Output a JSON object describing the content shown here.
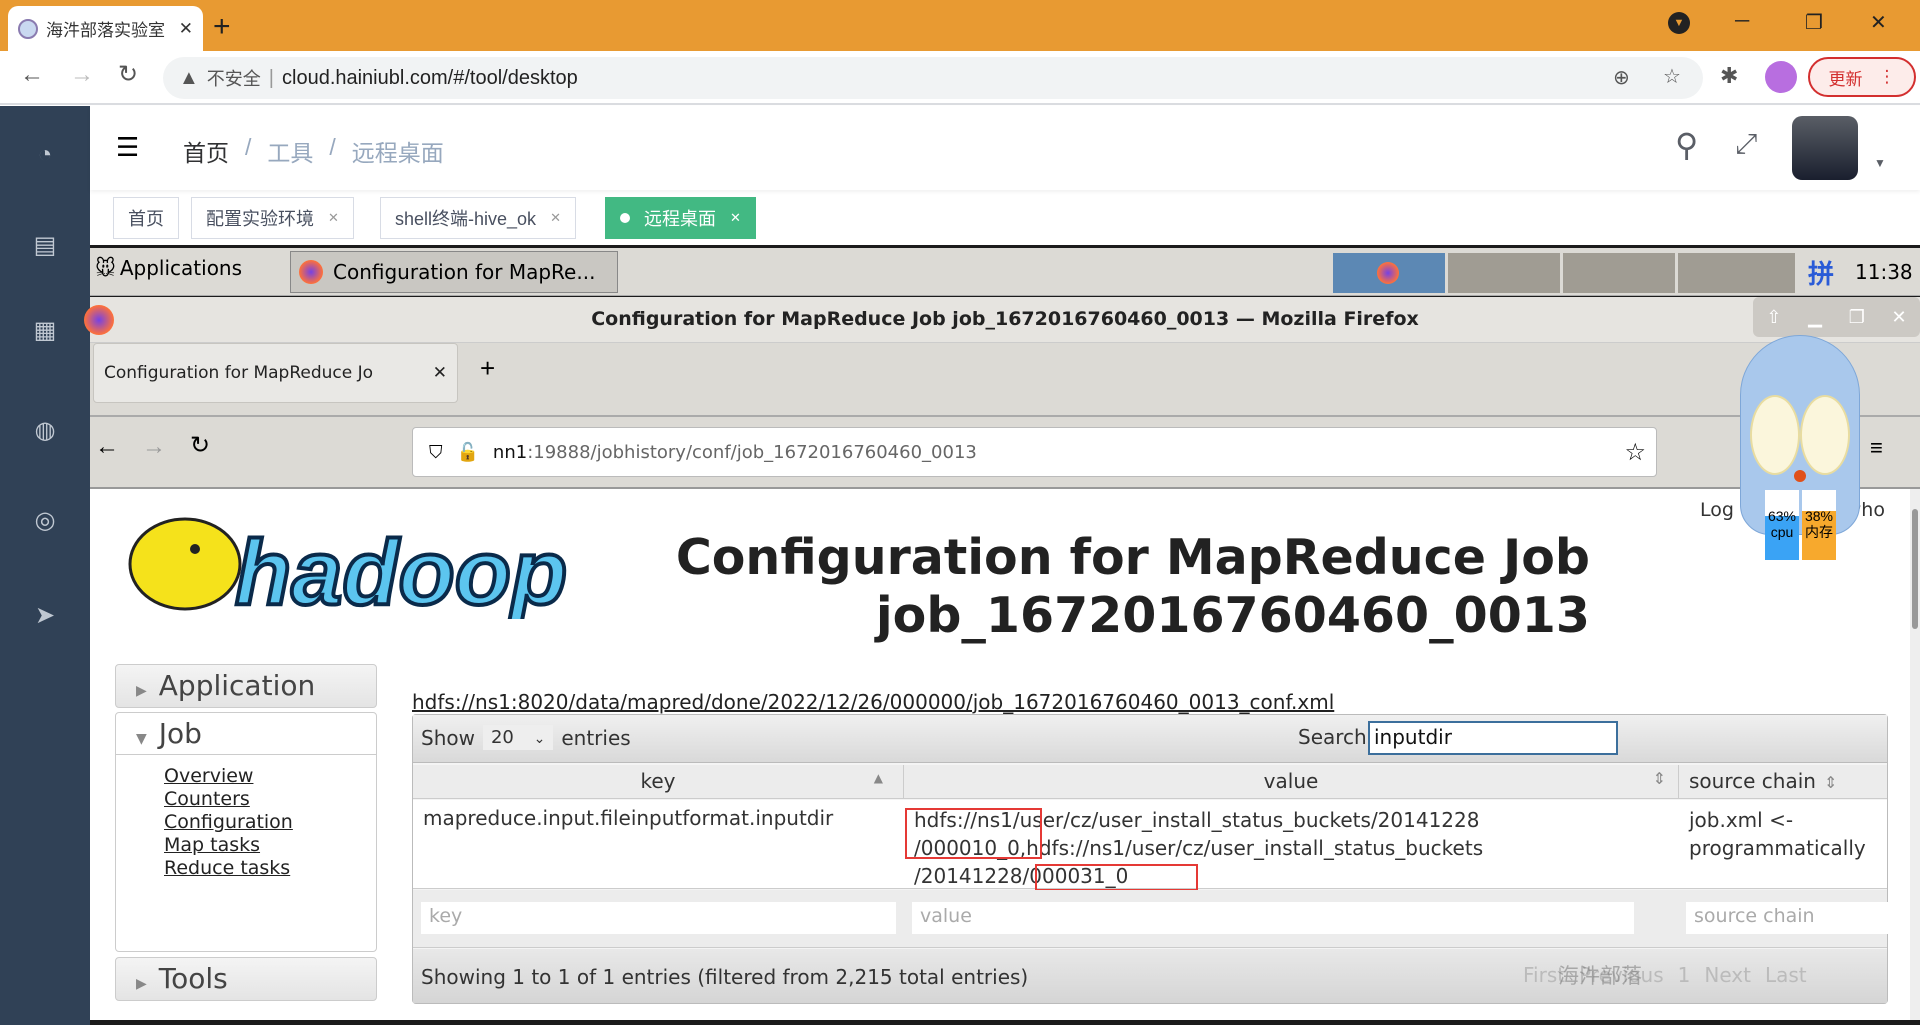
{
  "browser": {
    "tab_title": "海汼部落实验室 | 大数据学习云环",
    "url_security": "不安全",
    "url": "cloud.hainiubl.com/#/tool/desktop",
    "update_label": "更新",
    "colors": {
      "tabbar": "#E89A32"
    }
  },
  "app": {
    "breadcrumb": [
      "首页",
      "工具",
      "远程桌面"
    ],
    "tags": [
      {
        "label": "首页"
      },
      {
        "label": "配置实验环境"
      },
      {
        "label": "shell终端-hive_ok"
      },
      {
        "label": "远程桌面",
        "active": true
      }
    ],
    "accent": "#42b983",
    "sidebar_icons": [
      "dashboard-icon",
      "document-icon",
      "apps-icon",
      "globe-icon",
      "support-icon",
      "send-icon"
    ]
  },
  "desktop": {
    "applications_label": "Applications",
    "task_label": "Configuration for MapRe...",
    "ime": "拼",
    "clock": "11:38",
    "firefox": {
      "window_title": "Configuration for MapReduce Job job_1672016760460_0013 — Mozilla Firefox",
      "tab_title": "Configuration for MapReduce Jo",
      "url_host": "nn1",
      "url_rest": ":19888/jobhistory/conf/job_1672016760460_0013"
    },
    "monitor": {
      "cpu_pct": "63%",
      "cpu_label": "cpu",
      "cpu_value": 0.63,
      "mem_pct": "38%",
      "mem_label": "内存",
      "mem_value": 0.38
    },
    "page": {
      "logo": "hadoop",
      "heading1": "Configuration for MapReduce Job",
      "heading2": "job_1672016760460_0013",
      "login_left": "Log",
      "login_right": "rwho",
      "nav": {
        "application": "Application",
        "job": "Job",
        "links": [
          "Overview",
          "Counters",
          "Configuration",
          "Map tasks",
          "Reduce tasks"
        ],
        "tools": "Tools"
      },
      "conf_link": "hdfs://ns1:8020/data/mapred/done/2022/12/26/000000/job_1672016760460_0013_conf.xml",
      "show": "Show",
      "entries_value": "20",
      "entries": "entries",
      "search_label": "Search:",
      "search_value": "inputdir",
      "columns": [
        "key",
        "value",
        "source chain"
      ],
      "row": {
        "key": "mapreduce.input.fileinputformat.inputdir",
        "value_lines": [
          "hdfs://ns1/user/cz/user_install_status_buckets/20141228",
          "/000010_0,hdfs://ns1/user/cz/user_install_status_buckets",
          "/20141228/000031_0"
        ],
        "source": [
          "job.xml <-",
          "programmatically"
        ]
      },
      "filters": [
        "key",
        "value",
        "source chain"
      ],
      "info": "Showing 1 to 1 of 1 entries (filtered from 2,215 total entries)",
      "pager": [
        "First",
        "Previous",
        "1",
        "Next",
        "Last"
      ],
      "watermark": "海汼部落"
    }
  }
}
